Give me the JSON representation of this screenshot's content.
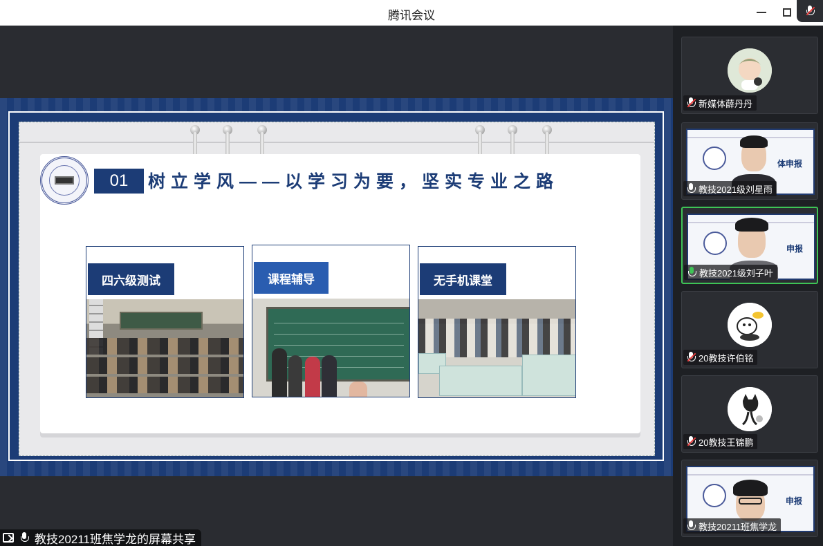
{
  "window": {
    "title": "腾讯会议"
  },
  "slide": {
    "number": "01",
    "title": "树立学风——以学习为要，坚实专业之路",
    "cards": [
      {
        "label": "四六级测试",
        "label_color": "#1c3c76"
      },
      {
        "label": "课程辅导",
        "label_color": "#2a5db0"
      },
      {
        "label": "无手机课堂",
        "label_color": "#1c3c76"
      }
    ]
  },
  "participants": [
    {
      "name": "新媒体薛丹丹",
      "mic": "muted"
    },
    {
      "name": "教技2021级刘星雨",
      "mic": "on",
      "screen_label": "体申报"
    },
    {
      "name": "教技2021级刘子叶",
      "mic": "speaking",
      "screen_label": "申报"
    },
    {
      "name": "20教技许伯铭",
      "mic": "muted"
    },
    {
      "name": "20教技王锦鹏",
      "mic": "muted"
    },
    {
      "name": "教技20211班焦学龙",
      "mic": "on",
      "screen_label": "申报"
    }
  ],
  "share_bar": {
    "label": "教技20211班焦学龙的屏幕共享"
  },
  "colors": {
    "slide_blue": "#1c3c76",
    "active_speaker": "#3ec456",
    "muted": "#e53b3b"
  }
}
